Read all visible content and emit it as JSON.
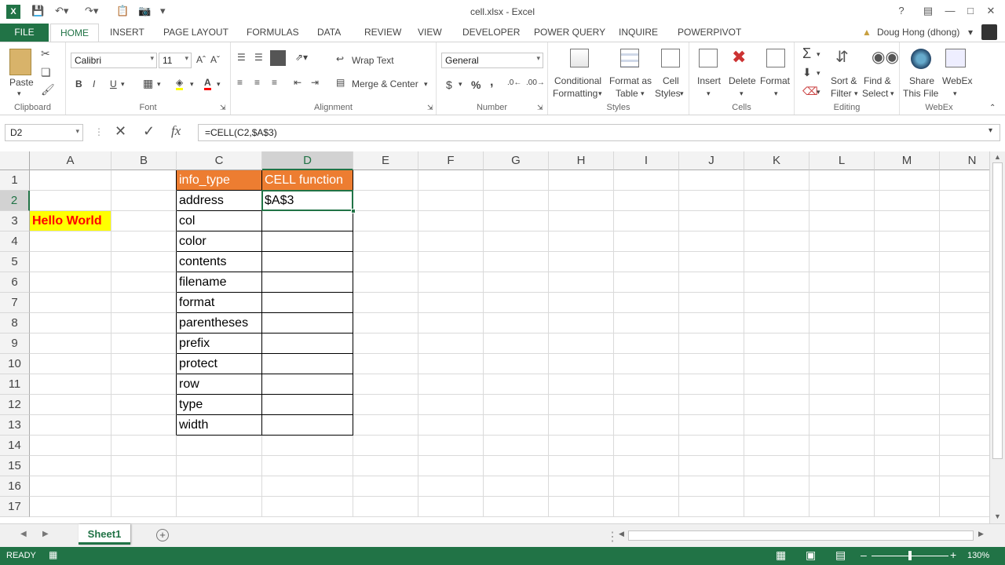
{
  "window": {
    "title": "cell.xlsx - Excel",
    "help": "?"
  },
  "ribbon_tabs": [
    "FILE",
    "HOME",
    "INSERT",
    "PAGE LAYOUT",
    "FORMULAS",
    "DATA",
    "REVIEW",
    "VIEW",
    "DEVELOPER",
    "POWER QUERY",
    "INQUIRE",
    "POWERPIVOT"
  ],
  "user": "Doug Hong (dhong)",
  "clipboard": {
    "paste": "Paste",
    "label": "Clipboard"
  },
  "font": {
    "name": "Calibri",
    "size": "11",
    "bold": "B",
    "italic": "I",
    "underline": "U",
    "label": "Font"
  },
  "alignment": {
    "wrap": "Wrap Text",
    "merge": "Merge & Center",
    "label": "Alignment"
  },
  "number": {
    "format": "General",
    "currency": "$",
    "percent": "%",
    "comma": ",",
    "label": "Number"
  },
  "styles": {
    "conditional": [
      "Conditional",
      "Formatting"
    ],
    "format_table": [
      "Format as",
      "Table"
    ],
    "cell_styles": [
      "Cell",
      "Styles"
    ],
    "label": "Styles"
  },
  "cells_group": {
    "insert": "Insert",
    "delete": "Delete",
    "format": "Format",
    "label": "Cells"
  },
  "editing": {
    "sort": [
      "Sort &",
      "Filter"
    ],
    "find": [
      "Find &",
      "Select"
    ],
    "label": "Editing"
  },
  "webex": {
    "share": [
      "Share",
      "This File"
    ],
    "webex": "WebEx",
    "label": "WebEx"
  },
  "formula_bar": {
    "name_box": "D2",
    "formula": "=CELL(C2,$A$3)",
    "fx": "fx"
  },
  "columns": [
    "A",
    "B",
    "C",
    "D",
    "E",
    "F",
    "G",
    "H",
    "I",
    "J",
    "K",
    "L",
    "M",
    "N"
  ],
  "rows": [
    "1",
    "2",
    "3",
    "4",
    "5",
    "6",
    "7",
    "8",
    "9",
    "10",
    "11",
    "12",
    "13",
    "14",
    "15",
    "16",
    "17"
  ],
  "cells": {
    "A3": "Hello World",
    "C1": "info_type",
    "D1": "CELL function",
    "D2": "$A$3",
    "C_list": [
      "address",
      "col",
      "color",
      "contents",
      "filename",
      "format",
      "parentheses",
      "prefix",
      "protect",
      "row",
      "type",
      "width"
    ]
  },
  "colors": {
    "excel_green": "#217346",
    "header_orange": "#ED7D31",
    "hello_bg": "#FFFF00",
    "hello_fg": "#FF0000"
  },
  "sheet_tab": "Sheet1",
  "status": {
    "ready": "READY",
    "zoom": "130%"
  }
}
